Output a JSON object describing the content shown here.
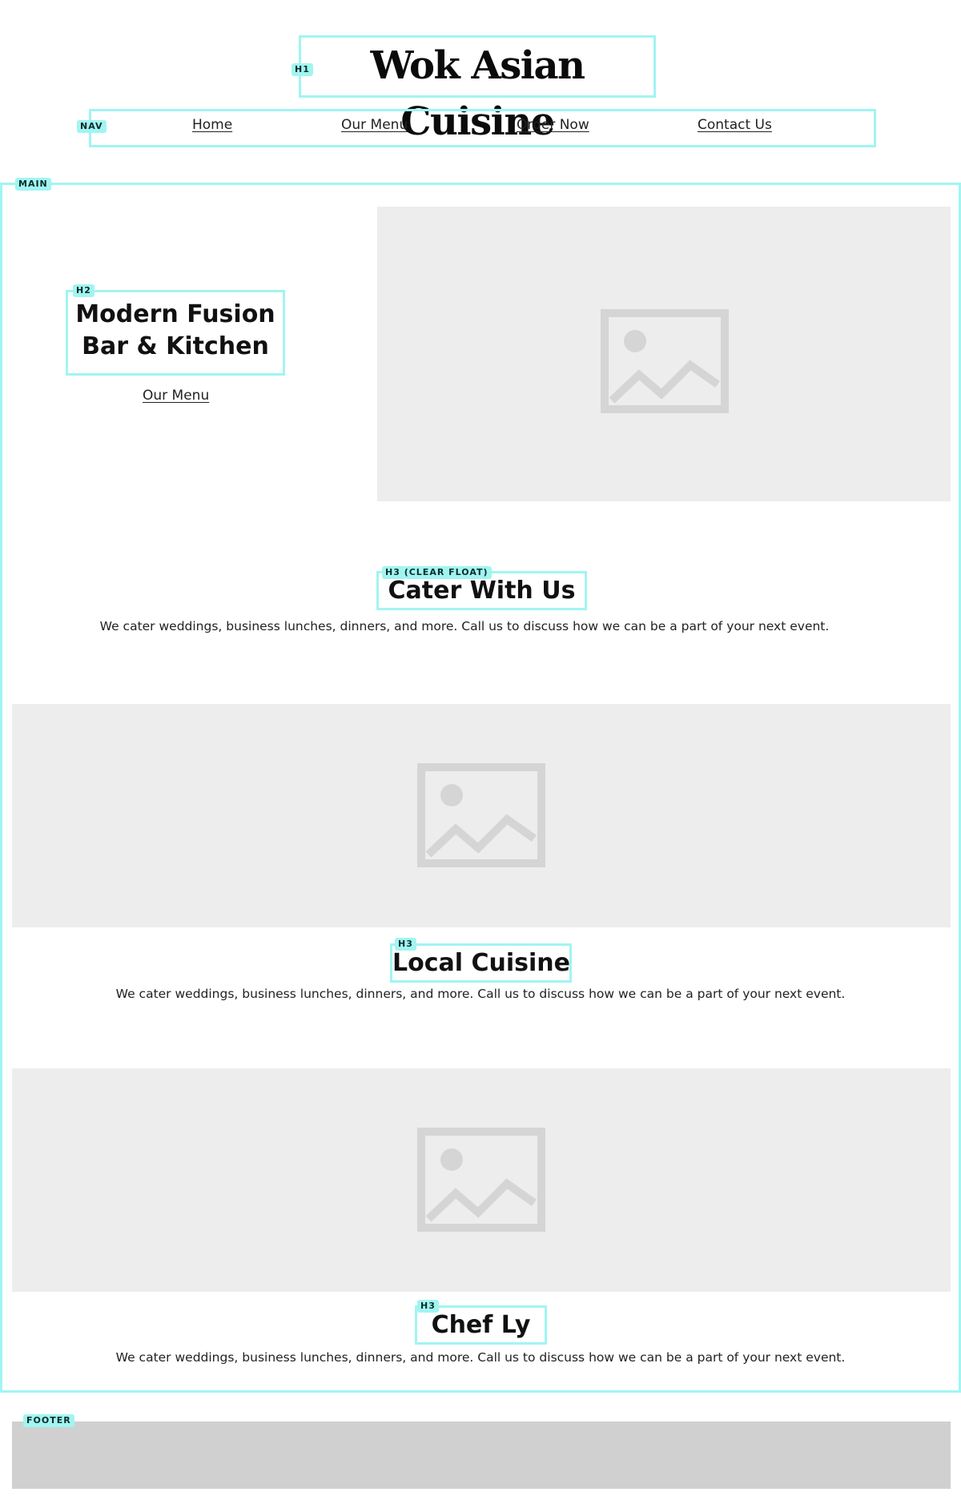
{
  "header": {
    "title": "Wok Asian Cuisine"
  },
  "nav": {
    "items": [
      {
        "label": "Home"
      },
      {
        "label": "Our Menu"
      },
      {
        "label": "Order Now"
      },
      {
        "label": "Contact Us"
      }
    ]
  },
  "hero": {
    "heading_line1": "Modern Fusion",
    "heading_line2": "Bar & Kitchen",
    "link_label": "Our Menu"
  },
  "sections": [
    {
      "title": "Cater With Us",
      "text": "We cater weddings, business lunches, dinners, and more. Call us to discuss how we can be a part of your next event."
    },
    {
      "title": "Local Cuisine",
      "text": "We cater weddings, business lunches, dinners, and more. Call us to discuss how we can be a part of your next event."
    },
    {
      "title": "Chef Ly",
      "text": "We cater weddings, business lunches, dinners, and more. Call us to discuss how we can be a part of your next event."
    }
  ],
  "tags": {
    "h1": "H1",
    "nav": "NAV",
    "main": "MAIN",
    "h2": "H2",
    "h3_clear": "H3 (CLEAR FLOAT)",
    "h3": "H3",
    "footer": "FOOTER"
  },
  "colors": {
    "outline": "#a1f5f1",
    "placeholder_bg": "#ededed",
    "placeholder_icon": "#d5d5d5",
    "footer_bg": "#d0d0d0"
  }
}
